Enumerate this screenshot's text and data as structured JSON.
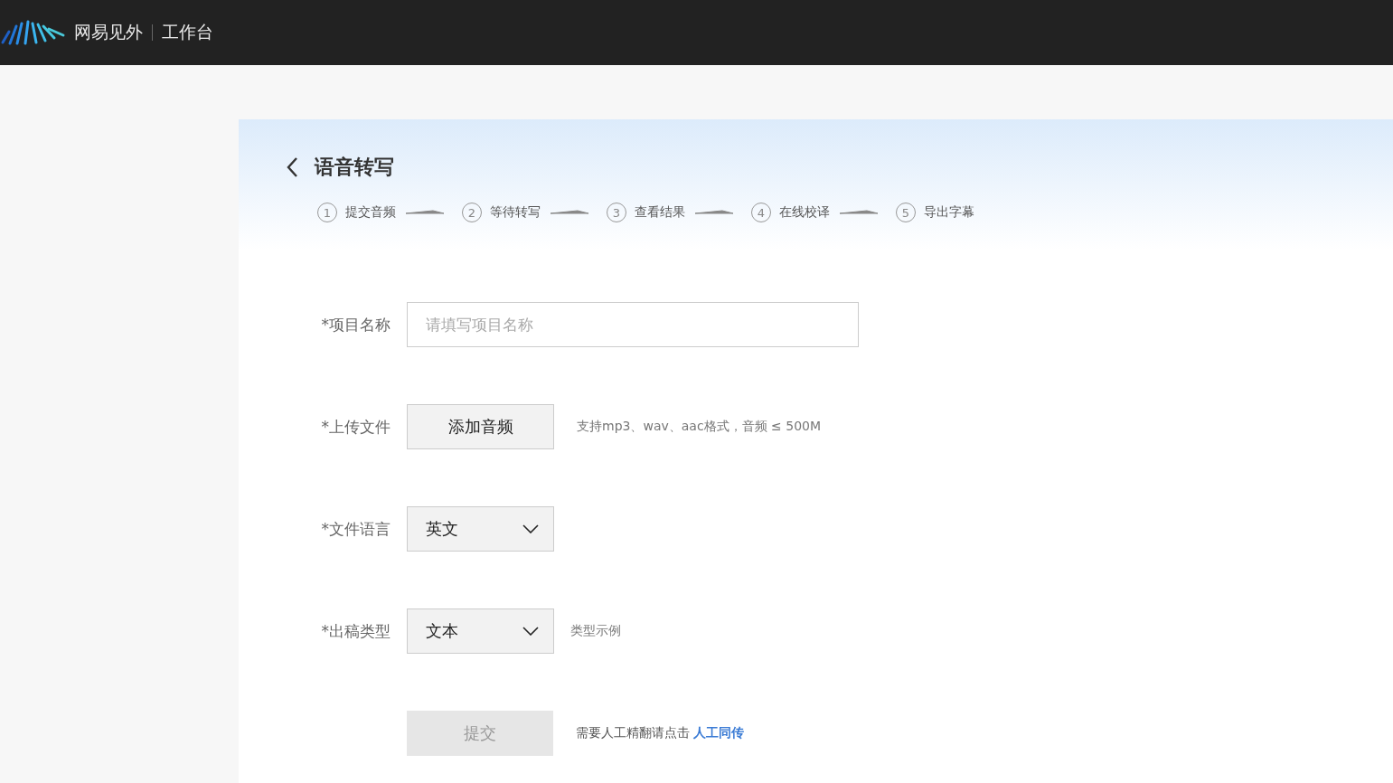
{
  "header": {
    "brand": "网易见外",
    "section": "工作台"
  },
  "page": {
    "title": "语音转写"
  },
  "steps": [
    {
      "number": "1",
      "label": "提交音频"
    },
    {
      "number": "2",
      "label": "等待转写"
    },
    {
      "number": "3",
      "label": "查看结果"
    },
    {
      "number": "4",
      "label": "在线校译"
    },
    {
      "number": "5",
      "label": "导出字幕"
    }
  ],
  "form": {
    "rows": [
      {
        "kind": "input",
        "label": "*项目名称",
        "placeholder": "请填写项目名称"
      },
      {
        "kind": "upload",
        "label": "*上传文件",
        "button": "添加音频",
        "hint": "支持mp3、wav、aac格式，音频 ≤ 500M"
      },
      {
        "kind": "select",
        "label": "*文件语言",
        "value": "英文"
      },
      {
        "kind": "select",
        "label": "*出稿类型",
        "value": "文本",
        "hint": "类型示例"
      }
    ]
  },
  "submit": {
    "label": "提交",
    "disabled": true,
    "note": "需要人工精翻请点击",
    "link": "人工同传"
  }
}
